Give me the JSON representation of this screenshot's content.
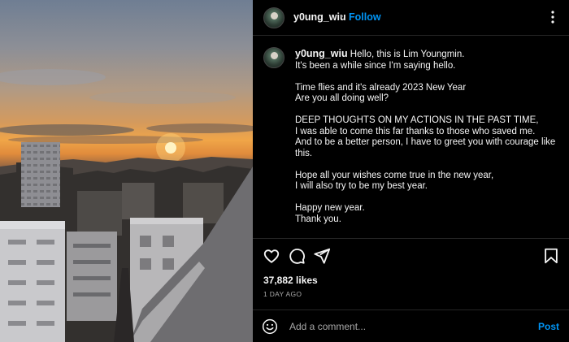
{
  "post": {
    "username": "y0ung_wiu",
    "separator": "•",
    "follow_label": "Follow",
    "caption_lines": [
      [
        "Hello, this is Lim Youngmin.",
        "It's been a while since I'm saying hello."
      ],
      [
        "Time flies and it's already 2023 New Year",
        "Are you all doing well?"
      ],
      [
        "DEEP THOUGHTS ON MY ACTIONS IN THE PAST TIME,",
        "I was able to come this far thanks to those who saved me.",
        "And to be a better person, I have to greet you with courage like this."
      ],
      [
        "Hope all your wishes come true in the new year,",
        "I will also try to be my best year."
      ],
      [
        "Happy new year.",
        "Thank you."
      ]
    ],
    "likes": "37,882 likes",
    "date": "1 DAY AGO"
  },
  "icons": {
    "more": "more-options-icon",
    "like": "heart-icon",
    "comment": "comment-icon",
    "share": "share-icon",
    "save": "bookmark-icon",
    "emoji": "emoji-icon"
  },
  "comment_box": {
    "placeholder": "Add a comment...",
    "post_label": "Post"
  },
  "colors": {
    "background": "#000000",
    "accent": "#0095f6",
    "muted": "#a8a8a8",
    "divider": "#262626"
  }
}
